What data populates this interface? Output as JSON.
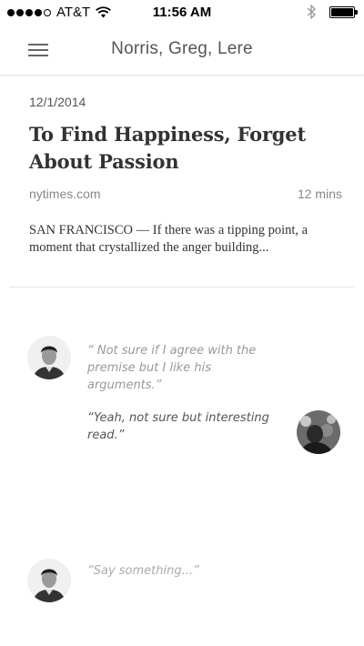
{
  "status_bar": {
    "carrier": "AT&T",
    "time": "11:56 AM",
    "signal_bars": 4,
    "signal_max": 5,
    "battery_level": 1.0,
    "icons": [
      "wifi-icon",
      "bluetooth-icon",
      "battery-icon"
    ]
  },
  "header": {
    "title": "Norris, Greg, Lere",
    "menu_icon": "hamburger-menu-icon"
  },
  "article": {
    "date": "12/1/2014",
    "headline": "To Find Happiness, Forget About Passion",
    "source": "nytimes.com",
    "read_time": "12 mins",
    "excerpt": "SAN FRANCISCO — If there was a tipping point, a moment that crystallized the anger building..."
  },
  "comments": [
    {
      "text": "“ Not sure if I agree with the premise but I like his arguments.”",
      "side": "left"
    },
    {
      "text": "“Yeah, not sure but interesting read.”",
      "side": "right"
    }
  ],
  "composer": {
    "placeholder": "“Say something...”"
  },
  "colors": {
    "background": "#ffffff",
    "title_text": "#333333",
    "muted_text": "#888888"
  }
}
